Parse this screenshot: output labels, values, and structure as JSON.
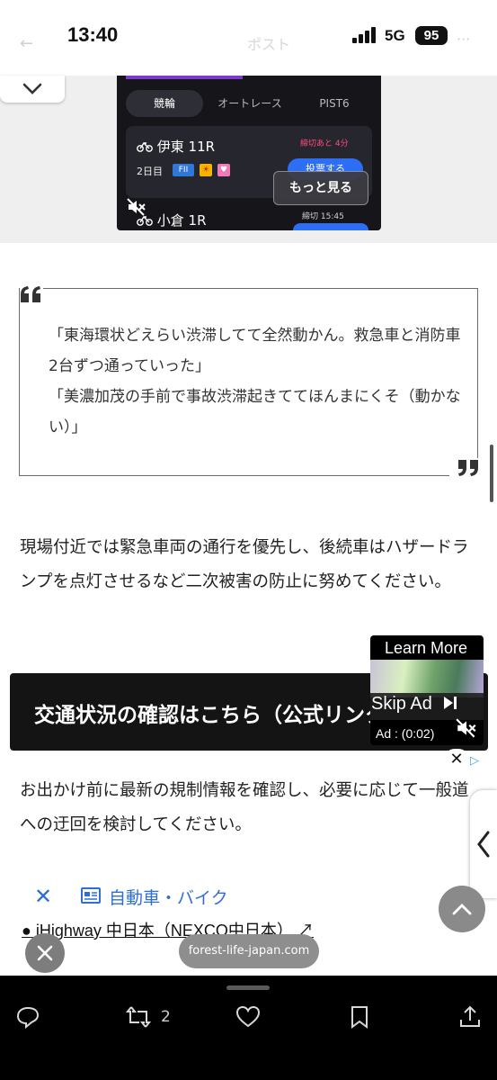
{
  "status_bar": {
    "time": "13:40",
    "network": "5G",
    "battery": "95",
    "ghost_title": "ポスト"
  },
  "ad": {
    "tabs": [
      "競輪",
      "オートレース",
      "PIST6"
    ],
    "race1": {
      "name": "伊東 11R",
      "day": "2日目",
      "deadline": "締切あと 4分",
      "vote": "投票する",
      "chips": [
        "FII",
        "☀",
        "♥"
      ]
    },
    "more_button": "もっと見る",
    "race2": {
      "name": "小倉 1R",
      "time": "締切 15:45"
    }
  },
  "quote": {
    "lines": [
      "「東海環状どえらい渋滞してて全然動かん。救急車と消防車2台ずつ通っていった」",
      "「美濃加茂の手前で事故渋滞起きててほんまにくそ（動かない）」"
    ]
  },
  "article": {
    "paragraph1": "現場付近では緊急車両の通行を優先し、後続車はハザードランプを点灯させるなど二次被害の防止に努めてください。",
    "banner": "交通状況の確認はこちら（公式リンク）",
    "paragraph2": "お出かけ前に最新の規制情報を確認し、必要に応じて一般道への迂回を検討してください。",
    "category": "自動車・バイク",
    "link": "iHighway 中日本（NEXCO中日本）"
  },
  "video_ad": {
    "learn_more": "Learn More",
    "skip": "Skip Ad",
    "timer": "Ad : (0:02)"
  },
  "footer": {
    "domain": "forest-life-japan.com",
    "retweet_count": "2"
  },
  "colors": {
    "link_blue": "#2e6fd6",
    "ad_accent_pink": "#ff4d7a",
    "ad_button_blue": "#2d6ef5"
  }
}
